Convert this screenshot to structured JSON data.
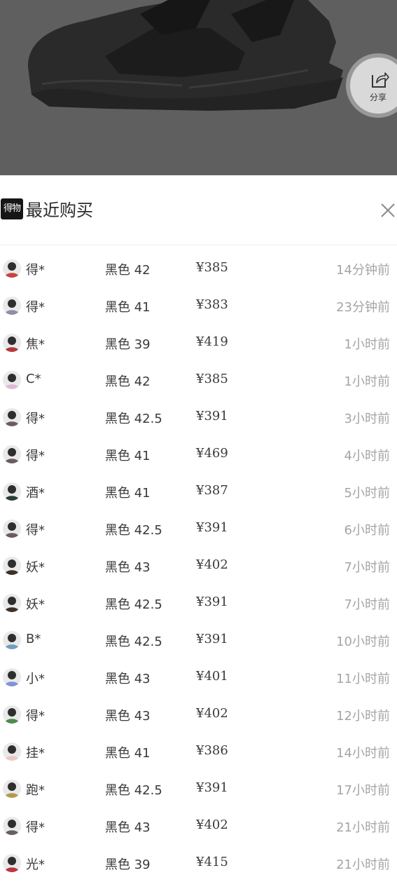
{
  "share": {
    "label": "分享"
  },
  "sheet": {
    "logo_text": "得物",
    "title": "最近购买"
  },
  "purchases": [
    {
      "name": "得*",
      "variant": "黑色 42",
      "price": "¥385",
      "time": "14分钟前",
      "avatar_color": "#c9423c"
    },
    {
      "name": "得*",
      "variant": "黑色 41",
      "price": "¥383",
      "time": "23分钟前",
      "avatar_color": "#8f8ea6"
    },
    {
      "name": "焦*",
      "variant": "黑色 39",
      "price": "¥419",
      "time": "1小时前",
      "avatar_color": "#b23a3a"
    },
    {
      "name": "C*",
      "variant": "黑色 42",
      "price": "¥385",
      "time": "1小时前",
      "avatar_color": "#e2b7d6"
    },
    {
      "name": "得*",
      "variant": "黑色 42.5",
      "price": "¥391",
      "time": "3小时前",
      "avatar_color": "#6a5d5f"
    },
    {
      "name": "得*",
      "variant": "黑色 41",
      "price": "¥469",
      "time": "4小时前",
      "avatar_color": "#6a5d5f"
    },
    {
      "name": "酒*",
      "variant": "黑色 41",
      "price": "¥387",
      "time": "5小时前",
      "avatar_color": "#2a3b3a"
    },
    {
      "name": "得*",
      "variant": "黑色 42.5",
      "price": "¥391",
      "time": "6小时前",
      "avatar_color": "#6a5d5f"
    },
    {
      "name": "妖*",
      "variant": "黑色 43",
      "price": "¥402",
      "time": "7小时前",
      "avatar_color": "#3d3028"
    },
    {
      "name": "妖*",
      "variant": "黑色 42.5",
      "price": "¥391",
      "time": "7小时前",
      "avatar_color": "#3d3028"
    },
    {
      "name": "B*",
      "variant": "黑色 42.5",
      "price": "¥391",
      "time": "10小时前",
      "avatar_color": "#6f9fbf"
    },
    {
      "name": "小*",
      "variant": "黑色 43",
      "price": "¥401",
      "time": "11小时前",
      "avatar_color": "#7f93d4"
    },
    {
      "name": "得*",
      "variant": "黑色 43",
      "price": "¥402",
      "time": "12小时前",
      "avatar_color": "#4d8a4e"
    },
    {
      "name": "挂*",
      "variant": "黑色 41",
      "price": "¥386",
      "time": "14小时前",
      "avatar_color": "#e8c9c4"
    },
    {
      "name": "跑*",
      "variant": "黑色 42.5",
      "price": "¥391",
      "time": "17小时前",
      "avatar_color": "#b39a52"
    },
    {
      "name": "得*",
      "variant": "黑色 43",
      "price": "¥402",
      "time": "21小时前",
      "avatar_color": "#6a5d5f"
    },
    {
      "name": "光*",
      "variant": "黑色 39",
      "price": "¥415",
      "time": "21小时前",
      "avatar_color": "#b8363f"
    }
  ]
}
